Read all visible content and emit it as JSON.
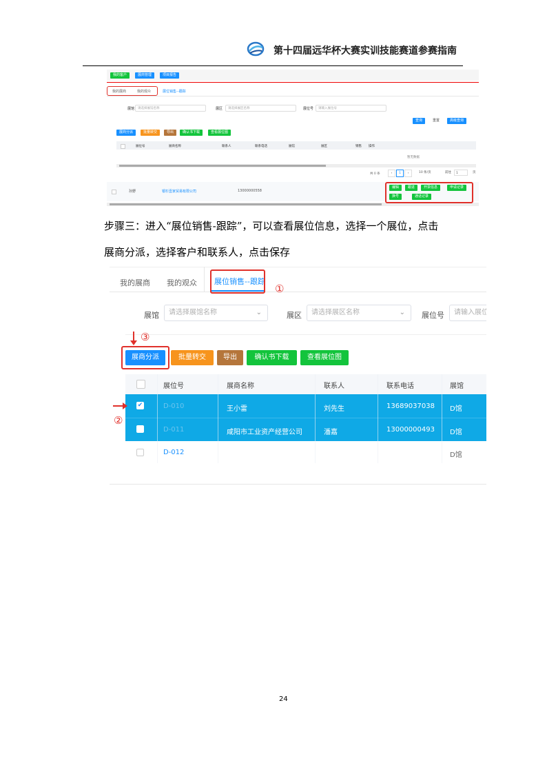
{
  "header": {
    "title": "第十四届远华杯大赛实训技能赛道参赛指南",
    "logo_icon": "swirl-logo-icon"
  },
  "shot1": {
    "top_buttons": [
      "我的客户",
      "展商管理",
      "项目报告"
    ],
    "tabs": [
      "我的展商",
      "我的观众",
      "展位销售--跟踪"
    ],
    "filters": {
      "hall_label": "展馆",
      "hall_placeholder": "请选择展馆名称",
      "area_label": "展区",
      "area_placeholder": "请选择展区名称",
      "booth_label": "展位号",
      "booth_placeholder": "请输入展位号"
    },
    "search_buttons": [
      "查询",
      "重置",
      "高级查询"
    ],
    "action_buttons": [
      "展商分派",
      "批量转交",
      "导出",
      "确认书下载",
      "查看展位图"
    ],
    "columns": [
      "展位号",
      "展商名称",
      "联系人",
      "联系电话",
      "展馆",
      "展区",
      "销售",
      "操作"
    ],
    "empty_text": "暂无数据",
    "pagination": {
      "total": "共 0 条",
      "page": "1",
      "page_size": "10 条/页",
      "goto_label": "前往",
      "goto_value": "1",
      "page_unit": "页"
    },
    "overlay_row": {
      "name": "孙野",
      "company": "银杉壹家贸易有限公司",
      "phone": "13000000558"
    },
    "op_buttons": [
      "编辑",
      "跟进",
      "开票信息",
      "申请记录",
      "换号",
      "通话记录"
    ]
  },
  "step_text": {
    "line1": "步骤三：进入“展位销售-跟踪”，可以查看展位信息，选择一个展位，点击",
    "line2": "展商分派，选择客户和联系人，点击保存"
  },
  "shot2": {
    "tabs": [
      "我的展商",
      "我的观众",
      "展位销售--跟踪"
    ],
    "filters": {
      "hall_label": "展馆",
      "hall_placeholder": "请选择展馆名称",
      "area_label": "展区",
      "area_placeholder": "请选择展区名称",
      "booth_label": "展位号",
      "booth_placeholder": "请输入展位"
    },
    "buttons": [
      "展商分派",
      "批量转交",
      "导出",
      "确认书下载",
      "查看展位图"
    ],
    "columns": [
      "展位号",
      "展商名称",
      "联系人",
      "联系电话",
      "展馆"
    ],
    "rows": [
      {
        "booth": "D-010",
        "company": "王小雷",
        "contact": "刘先生",
        "phone": "13689037038",
        "hall": "D馆",
        "checked": true
      },
      {
        "booth": "D-011",
        "company": "咸阳市工业资产经营公司",
        "contact": "潘嘉",
        "phone": "13000000493",
        "hall": "D馆",
        "checked": false
      },
      {
        "booth": "D-012",
        "company": "",
        "contact": "",
        "phone": "",
        "hall": "D馆",
        "checked": false
      }
    ],
    "markers": [
      "①",
      "②",
      "③"
    ]
  },
  "page_number": "24",
  "colors": {
    "primary": "#1890ff",
    "green": "#13c43c",
    "orange": "#f7941d",
    "brown": "#b5763b",
    "row_highlight": "#0fa9e6",
    "marker_red": "#e0302a"
  }
}
